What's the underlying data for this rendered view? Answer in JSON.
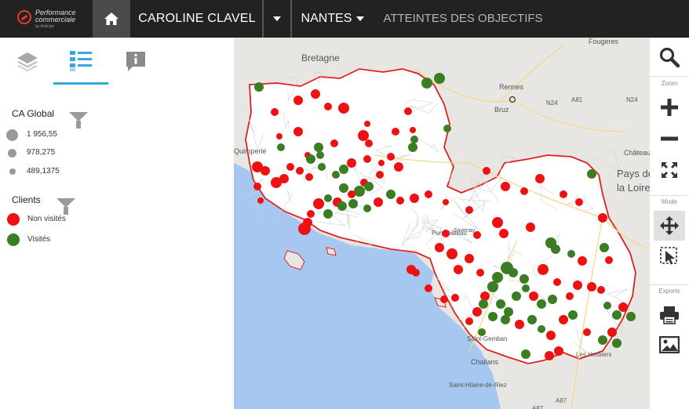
{
  "header": {
    "logo": {
      "line1": "Performance",
      "line2": "commerciale",
      "line3": "by Anticipe"
    },
    "user_name": "CAROLINE CLAVEL",
    "region": "NANTES",
    "objectives": "ATTEINTES DES OBJECTIFS"
  },
  "panel": {
    "tabs": [
      {
        "name": "layers",
        "icon": "layers-icon",
        "active": false
      },
      {
        "name": "legend",
        "icon": "list-icon",
        "active": true
      },
      {
        "name": "info",
        "icon": "info-icon",
        "active": false
      }
    ],
    "ca_title": "CA Global",
    "ca_sizes": [
      {
        "label": "1 956,55"
      },
      {
        "label": "978,275"
      },
      {
        "label": "489,1375"
      }
    ],
    "clients_title": "Clients",
    "clients": [
      {
        "label": "Non visités",
        "color": "#ee1111"
      },
      {
        "label": "Visités",
        "color": "#3a7d22"
      }
    ]
  },
  "map": {
    "places": [
      "Bretagne",
      "Rennes",
      "Bruz",
      "Fougeres",
      "Quimperlé",
      "Château",
      "Pays de",
      "la Loire",
      "Pontchâteau",
      "Saint-Gemban",
      "Challans",
      "Saint-Hilaire-de-Riez",
      "Les Herbiers",
      "A87",
      "A87",
      "N24",
      "A81",
      "N24",
      "Savenay"
    ]
  },
  "toolbar": {
    "zoom_label": "Zoom",
    "mode_label": "Mode",
    "exports_label": "Exports"
  }
}
